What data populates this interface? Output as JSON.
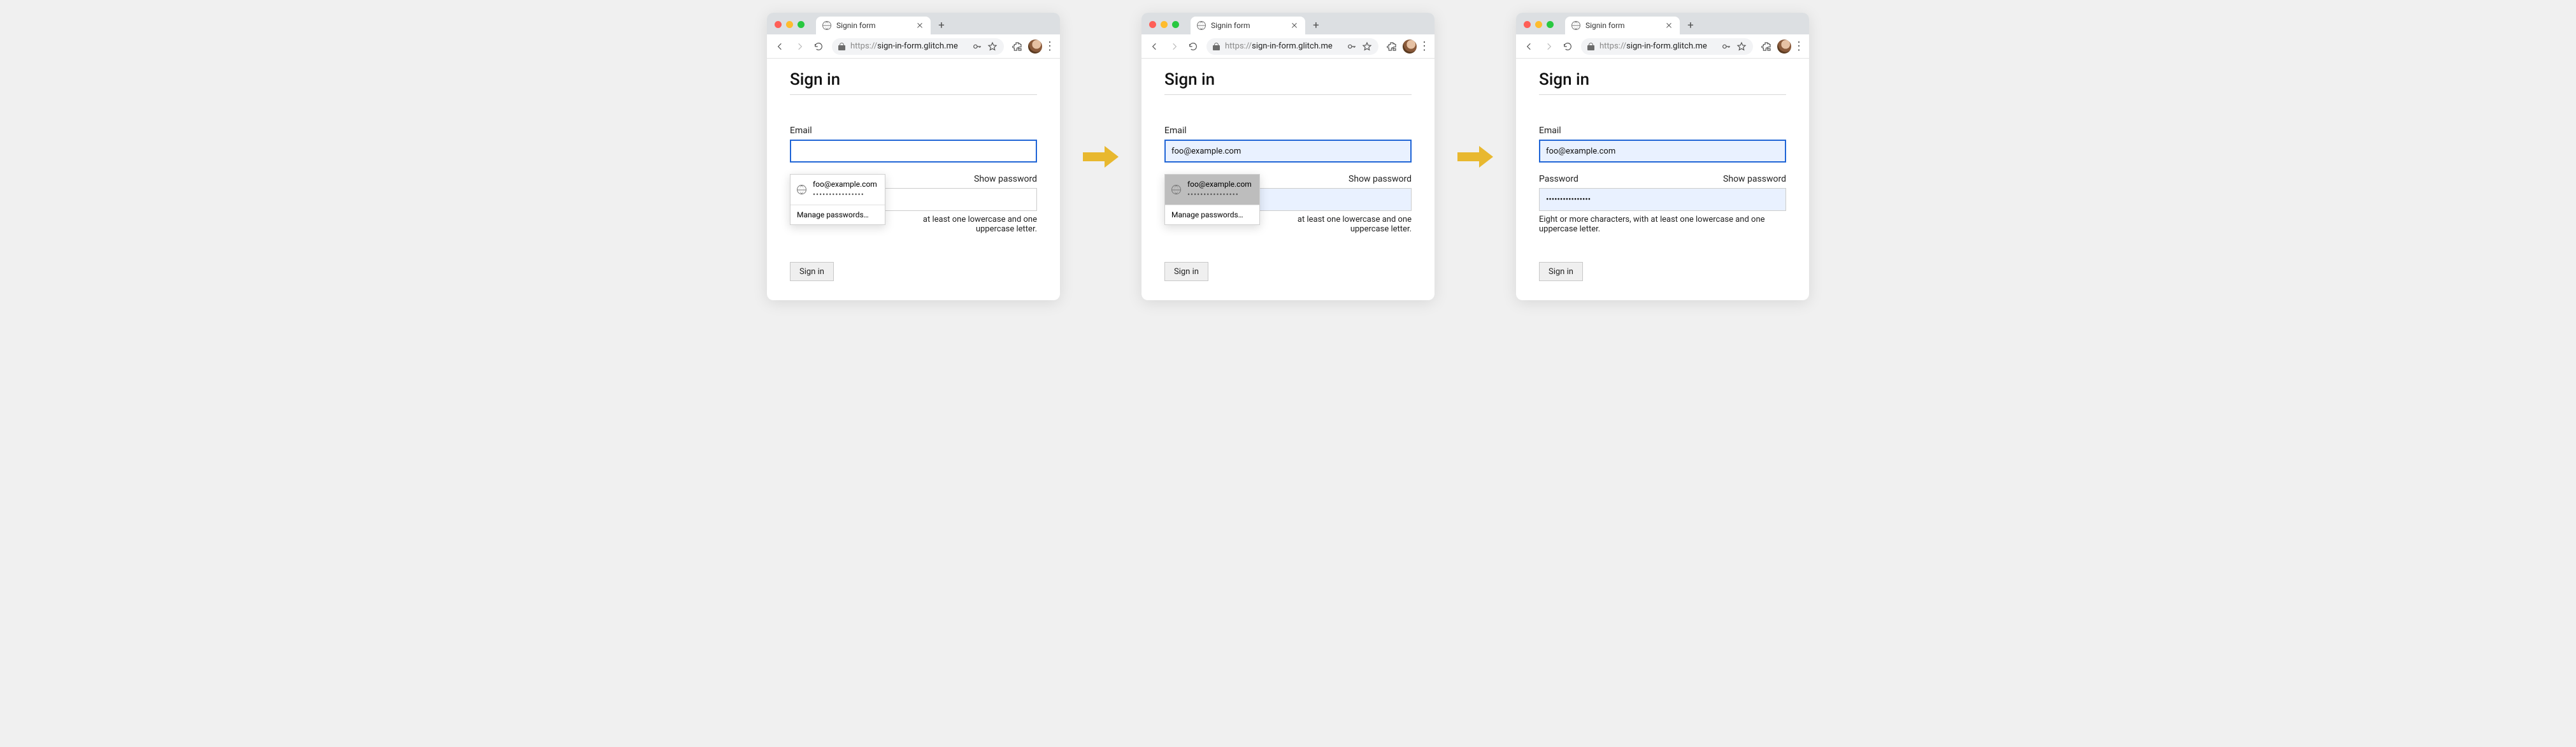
{
  "browser": {
    "tab_title": "Signin form",
    "url_scheme": "https://",
    "url_rest": "sign-in-form.glitch.me"
  },
  "page": {
    "heading": "Sign in",
    "email_label": "Email",
    "password_label": "Password",
    "show_password": "Show password",
    "password_help": "Eight or more characters, with at least one lowercase and one uppercase letter.",
    "submit_label": "Sign in"
  },
  "autofill": {
    "email": "foo@example.com",
    "password_mask": "••••••••••••••••",
    "manage": "Manage passwords…"
  },
  "values": {
    "screen2_email": "foo@example.com",
    "screen3_email": "foo@example.com",
    "screen3_password": "••••••••••••••••"
  }
}
